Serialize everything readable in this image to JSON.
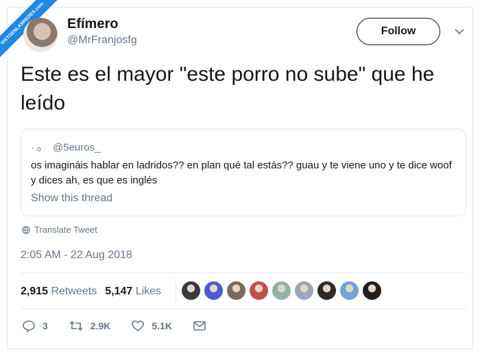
{
  "watermark": "VISTOENLASREDES.com",
  "author": {
    "name": "Efímero",
    "handle": "@MrFranjosfg"
  },
  "follow_label": "Follow",
  "tweet_text": "Este es el mayor \"este porro no sube\" que he leído",
  "quote": {
    "handle": "@5euros_",
    "text": "os imagináis hablar en ladridos?? en plan qué tal estás?? guau y te viene uno y te dice woof y dices ah, es que es inglés",
    "thread_link": "Show this thread"
  },
  "translate_label": "Translate Tweet",
  "timestamp": "2:05 AM - 22 Aug 2018",
  "stats": {
    "retweets_count": "2,915",
    "retweets_label": "Retweets",
    "likes_count": "5,147",
    "likes_label": "Likes"
  },
  "likers": [
    "#3a3a3a",
    "#4a5bd6",
    "#7a6a5a",
    "#c0504d",
    "#8fb3a8",
    "#9aa7b8",
    "#2b2b2b",
    "#6aa6d9",
    "#1f1f1f"
  ],
  "actions": {
    "replies": "3",
    "retweets": "2.9K",
    "likes": "5.1K"
  },
  "colors": {
    "text": "#14171a",
    "secondary": "#657786",
    "border": "#e1e8ed"
  }
}
